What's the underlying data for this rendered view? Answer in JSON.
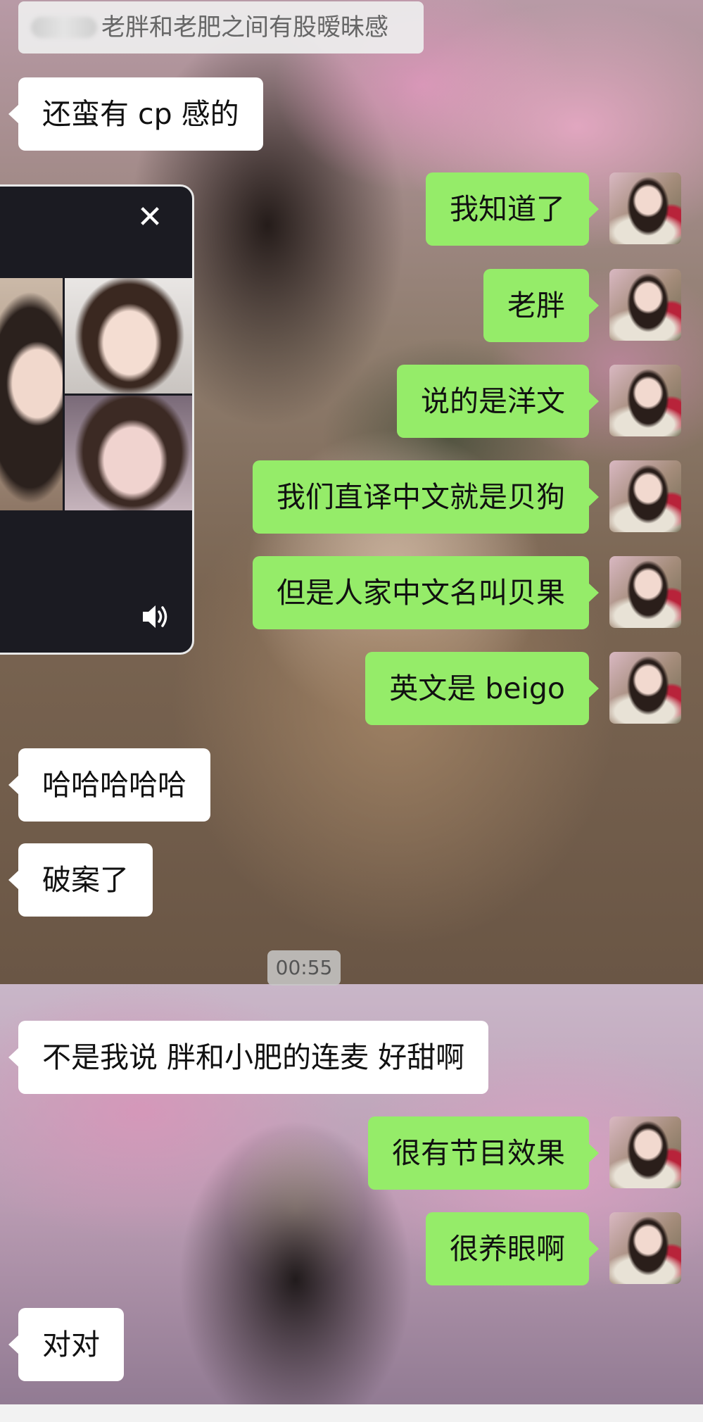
{
  "system_notice": {
    "text": "老胖和老肥之间有股暧昧感"
  },
  "timestamp": "00:55",
  "video_call": {
    "close_icon": "close-icon",
    "speaker_icon": "speaker-volume-icon"
  },
  "messages": [
    {
      "side": "left",
      "text": "还蛮有 cp 感的"
    },
    {
      "side": "right",
      "text": "我知道了"
    },
    {
      "side": "right",
      "text": "老胖"
    },
    {
      "side": "right",
      "text": "说的是洋文"
    },
    {
      "side": "right",
      "text": "我们直译中文就是贝狗"
    },
    {
      "side": "right",
      "text": "但是人家中文名叫贝果"
    },
    {
      "side": "right",
      "text": "英文是 beigo"
    },
    {
      "side": "left",
      "text": "哈哈哈哈哈"
    },
    {
      "side": "left",
      "text": "破案了"
    },
    {
      "side": "left",
      "text": "不是我说 胖和小肥的连麦 好甜啊"
    },
    {
      "side": "right",
      "text": "很有节目效果"
    },
    {
      "side": "right",
      "text": "很养眼啊"
    },
    {
      "side": "left",
      "text": "对对"
    }
  ]
}
